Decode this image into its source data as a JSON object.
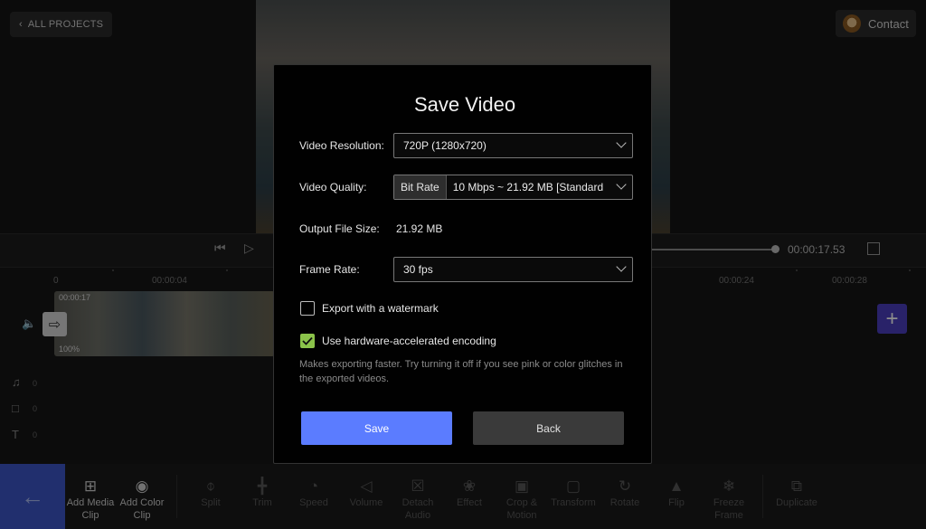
{
  "header": {
    "all_projects_label": "ALL PROJECTS",
    "contact_label": "Contact"
  },
  "player": {
    "time": "00:00:17.53"
  },
  "timeline": {
    "ruler": [
      "0",
      "00:00:04",
      "00:00:24",
      "00:00:28"
    ],
    "clip_duration": "00:00:17",
    "clip_volume": "100%",
    "audio_count": "0",
    "sticker_count": "0",
    "text_count": "0"
  },
  "toolbar": {
    "items": [
      {
        "label": "Add Media Clip",
        "icon": "add-media-icon",
        "enabled": true
      },
      {
        "label": "Add Color Clip",
        "icon": "palette-icon",
        "enabled": true
      },
      {
        "label": "Split",
        "icon": "split-icon",
        "enabled": false
      },
      {
        "label": "Trim",
        "icon": "trim-icon",
        "enabled": false
      },
      {
        "label": "Speed",
        "icon": "speed-icon",
        "enabled": false
      },
      {
        "label": "Volume",
        "icon": "volume-icon",
        "enabled": false
      },
      {
        "label": "Detach Audio",
        "icon": "detach-audio-icon",
        "enabled": false
      },
      {
        "label": "Effect",
        "icon": "effect-icon",
        "enabled": false
      },
      {
        "label": "Crop & Motion",
        "icon": "crop-icon",
        "enabled": false
      },
      {
        "label": "Transform",
        "icon": "transform-icon",
        "enabled": false
      },
      {
        "label": "Rotate",
        "icon": "rotate-icon",
        "enabled": false
      },
      {
        "label": "Flip",
        "icon": "flip-icon",
        "enabled": false
      },
      {
        "label": "Freeze Frame",
        "icon": "snowflake-icon",
        "enabled": false
      },
      {
        "label": "Duplicate",
        "icon": "duplicate-icon",
        "enabled": false
      }
    ]
  },
  "dialog": {
    "title": "Save Video",
    "resolution_label": "Video Resolution:",
    "resolution_value": "720P (1280x720)",
    "quality_label": "Video Quality:",
    "quality_mode": "Bit Rate",
    "quality_value": "10 Mbps ~ 21.92 MB [Standard",
    "size_label": "Output File Size:",
    "size_value": "21.92 MB",
    "framerate_label": "Frame Rate:",
    "framerate_value": "30 fps",
    "watermark_label": "Export with a watermark",
    "watermark_checked": false,
    "hw_label": "Use hardware-accelerated encoding",
    "hw_checked": true,
    "hw_note": "Makes exporting faster. Try turning it off if you see pink or color glitches in the exported videos.",
    "save_label": "Save",
    "back_label": "Back"
  },
  "colors": {
    "accent": "#5b7cff",
    "check": "#8bc34a",
    "add_track": "#4b3fbf"
  }
}
